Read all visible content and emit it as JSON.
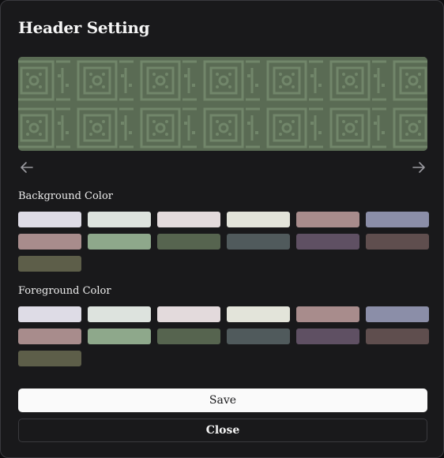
{
  "dialog": {
    "title": "Header Setting",
    "preview": {
      "pattern_name": "geometric-tile-pattern",
      "background_color": "#5a6b54",
      "foreground_color": "#718566"
    },
    "prev_icon": "arrow-left-icon",
    "next_icon": "arrow-right-icon",
    "background_section": {
      "label": "Background Color",
      "colors": [
        "#dedce6",
        "#dde3de",
        "#e3dadc",
        "#e3e4da",
        "#a88c8c",
        "#8b8ea8",
        "#a88c8c",
        "#8ea88b",
        "#56644f",
        "#505a5c",
        "#5f5063",
        "#5f4e4e",
        "#5d5e49"
      ]
    },
    "foreground_section": {
      "label": "Foreground Color",
      "colors": [
        "#dedce6",
        "#dde3de",
        "#e3dadc",
        "#e3e4da",
        "#a88c8c",
        "#8b8ea8",
        "#a88c8c",
        "#8ea88b",
        "#56644f",
        "#505a5c",
        "#5f5063",
        "#5f4e4e",
        "#5d5e49"
      ]
    },
    "save_label": "Save",
    "close_label": "Close"
  }
}
